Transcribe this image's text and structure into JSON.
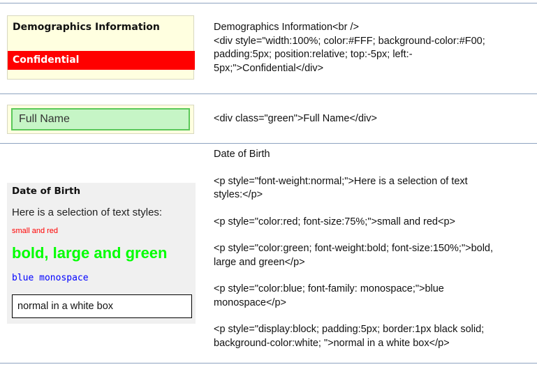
{
  "rows": [
    {
      "example": {
        "heading": "Demographics Information",
        "banner": "Confidential"
      },
      "code": [
        "Demographics Information<br />",
        "<div style=\"width:100%; color:#FFF; background-color:#F00;",
        "padding:5px; position:relative; top:-5px; left:-",
        "5px;\">Confidential</div>"
      ]
    },
    {
      "example": {
        "field": "Full Name"
      },
      "code": [
        "<div class=\"green\">Full Name</div>"
      ]
    },
    {
      "example": {
        "heading": "Date of Birth",
        "normal": "Here is a selection of text styles:",
        "small_red": "small and red",
        "bold_green": "bold, large and green",
        "blue_mono": "blue monospace",
        "white_box": "normal in a white box"
      },
      "code": [
        "Date of Birth",
        "<p style=\"font-weight:normal;\">Here is a selection of text",
        "styles:</p>",
        "<p style=\"color:red; font-size:75%;\">small and red<p>",
        "<p style=\"color:green; font-weight:bold; font-size:150%;\">bold,",
        "large and green</p>",
        "<p style=\"color:blue; font-family: monospace;\">blue",
        "monospace</p>",
        "<p style=\"display:block; padding:5px; border:1px black solid;",
        "background-color:white; \">normal in a white box</p>"
      ]
    }
  ],
  "colors": {
    "rule": "#8ea3c0",
    "confidential_bg": "#ff0000",
    "green_box": "#c6f5c6",
    "green_text": "#00ff00",
    "blue_text": "#0000ff"
  }
}
